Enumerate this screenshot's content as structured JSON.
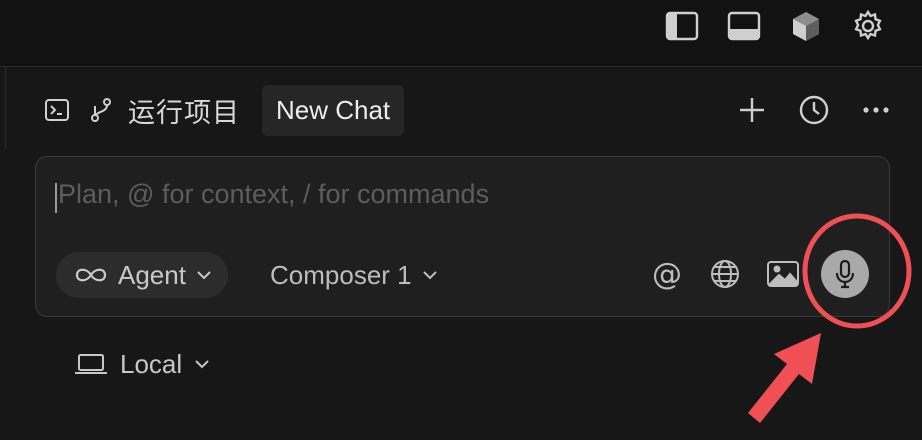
{
  "top_bar": {
    "icons": [
      "sidebar-left-icon",
      "panel-bottom-icon",
      "cube-icon",
      "gear-icon"
    ]
  },
  "header": {
    "project_title": "运行项目",
    "active_tab": "New Chat",
    "actions": [
      "plus-icon",
      "history-clock-icon",
      "more-dots-icon"
    ]
  },
  "composer": {
    "placeholder": "Plan, @ for context, / for commands",
    "mode_label": "Agent",
    "model_label": "Composer 1",
    "at_symbol": "@"
  },
  "location": {
    "label": "Local"
  },
  "colors": {
    "background": "#171717",
    "composer_bg": "#1f1f1f",
    "annotation_red": "#ef4f55",
    "mic_button": "#a9a9a9"
  }
}
